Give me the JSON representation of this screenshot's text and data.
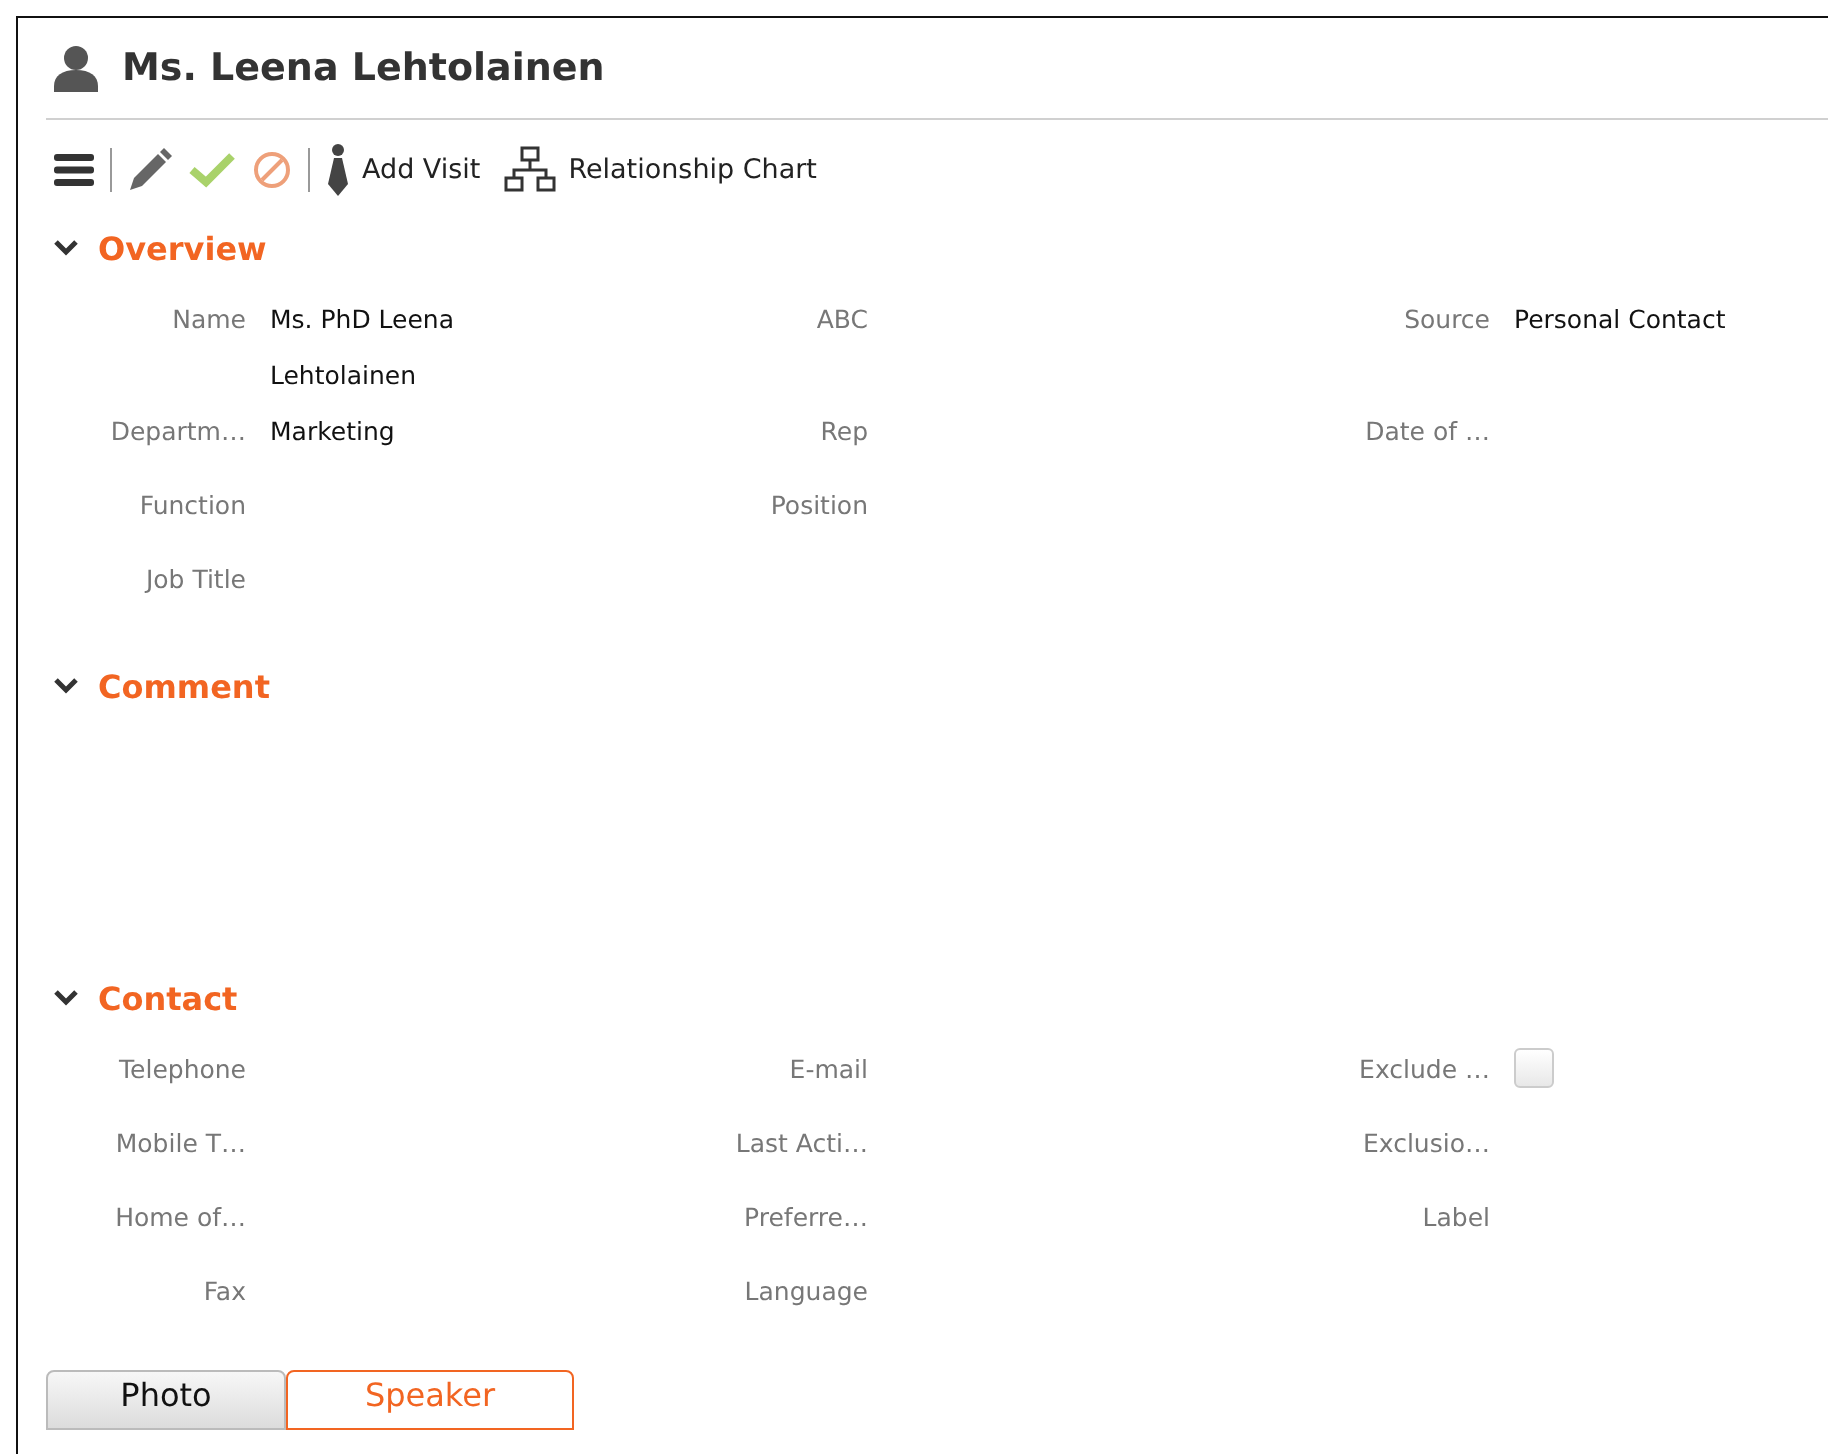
{
  "title": "Ms. Leena Lehtolainen",
  "toolbar": [
    {
      "kind": "menu"
    },
    {
      "kind": "separator"
    },
    {
      "kind": "edit"
    },
    {
      "kind": "save"
    },
    {
      "kind": "cancel"
    },
    {
      "kind": "separator"
    },
    {
      "kind": "visit",
      "label": "Add Visit"
    },
    {
      "kind": "chart",
      "label": "Relationship Chart"
    }
  ],
  "sections": [
    {
      "title": "Overview",
      "expanded": true,
      "rows": [
        [
          {
            "label": "Name",
            "value": "Ms. PhD Leena Lehtolainen"
          },
          {
            "label": "ABC"
          },
          {
            "label": "Source",
            "value": "Personal Contact"
          }
        ],
        [
          {
            "label": "Departm…",
            "value": "Marketing"
          },
          {
            "label": "Rep"
          },
          {
            "label": "Date of …"
          }
        ],
        [
          {
            "label": "Function"
          },
          {
            "label": "Position"
          }
        ],
        [
          {
            "label": "Job Title"
          }
        ]
      ]
    },
    {
      "title": "Comment",
      "expanded": true
    },
    {
      "title": "Contact",
      "expanded": true,
      "rows": [
        [
          {
            "label": "Telephone"
          },
          {
            "label": "E-mail"
          },
          {
            "label": "Exclude …",
            "kind": "checkbox",
            "checked": false
          }
        ],
        [
          {
            "label": "Mobile T…"
          },
          {
            "label": "Last Acti…"
          },
          {
            "label": "Exclusio…"
          }
        ],
        [
          {
            "label": "Home of…"
          },
          {
            "label": "Preferre…"
          },
          {
            "label": "Label"
          }
        ],
        [
          {
            "label": "Fax"
          },
          {
            "label": "Language"
          }
        ]
      ]
    }
  ],
  "tabs": [
    {
      "label": "Photo",
      "selected": false
    },
    {
      "label": "Speaker",
      "selected": true
    }
  ]
}
